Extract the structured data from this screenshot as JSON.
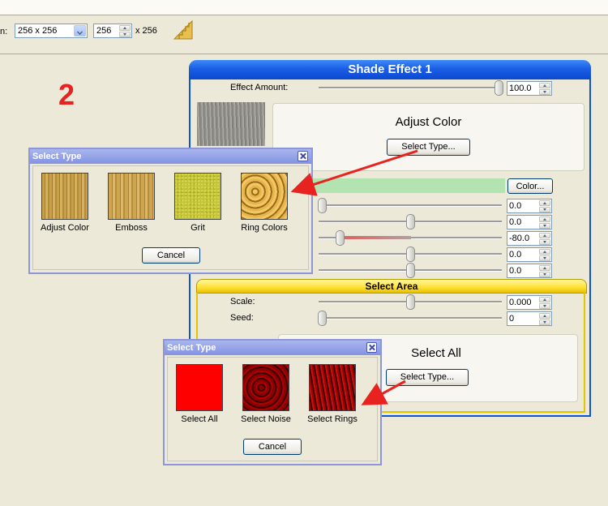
{
  "toolbar": {
    "size_prefix": "n:",
    "size_select": "256 x 256",
    "size_value": "256",
    "size_suffix": "x 256",
    "stair_icon": "staircase-icon"
  },
  "annotation": {
    "step_number": "2",
    "step_color": "#e8221e",
    "arrow_color": "#e8221e"
  },
  "shade_panel": {
    "title": "Shade Effect 1",
    "effect_amount_label": "Effect Amount:",
    "effect_amount_value": "100.0",
    "effect_amount_level": 1.0,
    "adjust_color_heading": "Adjust Color",
    "select_type_button": "Select Type...",
    "color_button": "Color...",
    "params": [
      {
        "value": "0.0",
        "level": 0.0
      },
      {
        "value": "0.0",
        "level": 0.5
      },
      {
        "value": "-80.0",
        "level": 0.1
      },
      {
        "value": "0.0",
        "level": 0.5
      },
      {
        "value": "0.0",
        "level": 0.5
      }
    ],
    "select_area": {
      "title": "Select Area",
      "scale_label": "Scale:",
      "scale_value": "0.000",
      "scale_level": 0.5,
      "seed_label": "Seed:",
      "seed_value": "0",
      "seed_level": 0.0,
      "heading": "Select All",
      "heading_partial": "c",
      "select_type_button": "Select Type..."
    }
  },
  "dialog_color": {
    "title": "Select Type",
    "options": [
      {
        "label": "Adjust Color",
        "texture": "wood1"
      },
      {
        "label": "Emboss",
        "texture": "wood2"
      },
      {
        "label": "Grit",
        "texture": "grit"
      },
      {
        "label": "Ring Colors",
        "texture": "rings"
      }
    ],
    "cancel": "Cancel"
  },
  "dialog_area": {
    "title": "Select Type",
    "options": [
      {
        "label": "Select All",
        "texture": "red-solid"
      },
      {
        "label": "Select Noise",
        "texture": "noise"
      },
      {
        "label": "Select Rings",
        "texture": "rred"
      }
    ],
    "cancel": "Cancel"
  }
}
